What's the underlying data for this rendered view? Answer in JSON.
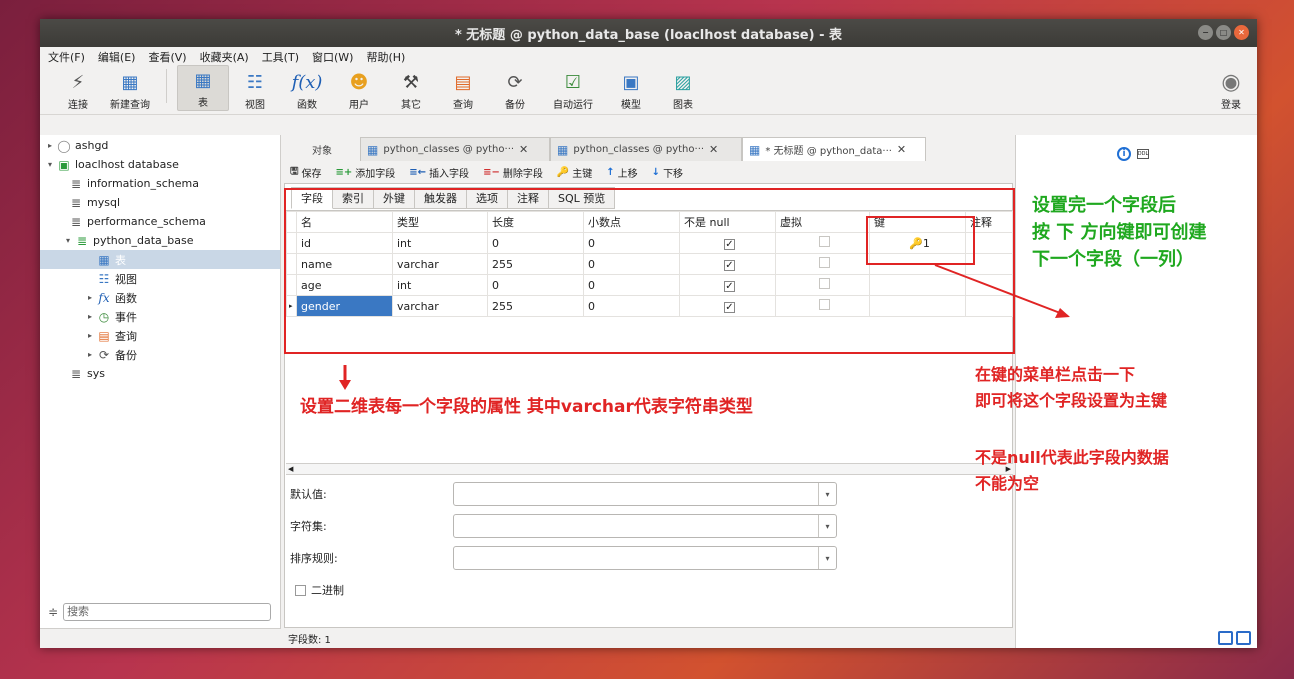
{
  "window": {
    "title": "* 无标题 @ python_data_base (loaclhost database) - 表"
  },
  "menu": [
    "文件(F)",
    "编辑(E)",
    "查看(V)",
    "收藏夹(A)",
    "工具(T)",
    "窗口(W)",
    "帮助(H)"
  ],
  "toolbar": {
    "connect": "连接",
    "new_query": "新建查询",
    "table": "表",
    "view": "视图",
    "function": "函数",
    "user": "用户",
    "other": "其它",
    "query": "查询",
    "backup": "备份",
    "auto_run": "自动运行",
    "model": "模型",
    "chart": "图表",
    "login": "登录"
  },
  "sidebar": {
    "items": [
      {
        "label": "ashgd"
      },
      {
        "label": "loaclhost database"
      },
      {
        "label": "information_schema"
      },
      {
        "label": "mysql"
      },
      {
        "label": "performance_schema"
      },
      {
        "label": "python_data_base"
      },
      {
        "label": "表"
      },
      {
        "label": "视图"
      },
      {
        "label": "函数"
      },
      {
        "label": "事件"
      },
      {
        "label": "查询"
      },
      {
        "label": "备份"
      },
      {
        "label": "sys"
      }
    ],
    "search_placeholder": "搜索"
  },
  "tabs": {
    "objects": "对象",
    "tab1": "python_classes @ pytho···",
    "tab2": "python_classes @ pytho···",
    "tab3": "* 无标题 @ python_data···"
  },
  "subtoolbar": {
    "save": "保存",
    "add_field": "添加字段",
    "insert_field": "插入字段",
    "delete_field": "删除字段",
    "primary_key": "主键",
    "move_up": "上移",
    "move_down": "下移"
  },
  "inner_tabs": [
    "字段",
    "索引",
    "外键",
    "触发器",
    "选项",
    "注释",
    "SQL 预览"
  ],
  "grid": {
    "headers": [
      "名",
      "类型",
      "长度",
      "小数点",
      "不是 null",
      "虚拟",
      "键",
      "注释"
    ],
    "rows": [
      {
        "name": "id",
        "type": "int",
        "length": "0",
        "decimals": "0",
        "not_null": true,
        "virtual": false,
        "key": "1"
      },
      {
        "name": "name",
        "type": "varchar",
        "length": "255",
        "decimals": "0",
        "not_null": true,
        "virtual": false,
        "key": ""
      },
      {
        "name": "age",
        "type": "int",
        "length": "0",
        "decimals": "0",
        "not_null": true,
        "virtual": false,
        "key": ""
      },
      {
        "name": "gender",
        "type": "varchar",
        "length": "255",
        "decimals": "0",
        "not_null": true,
        "virtual": false,
        "key": ""
      }
    ]
  },
  "props": {
    "default_label": "默认值:",
    "charset_label": "字符集:",
    "collation_label": "排序规则:",
    "binary_label": "二进制"
  },
  "status": {
    "field_count": "字段数: 1"
  },
  "annotations": {
    "top_right_1": "设置完一个字段后",
    "top_right_2": "按 下 方向键即可创建",
    "top_right_3": "下一个字段（一列）",
    "bottom_center": "设置二维表每一个字段的属性  其中varchar代表字符串类型",
    "key_1": "在键的菜单栏点击一下",
    "key_2": "即可将这个字段设置为主键",
    "null_1": "不是null代表此字段内数据",
    "null_2": "不能为空"
  },
  "colors": {
    "annotation_green": "#1fa81f",
    "annotation_red": "#e02424",
    "selection_blue": "#3a78c3"
  }
}
